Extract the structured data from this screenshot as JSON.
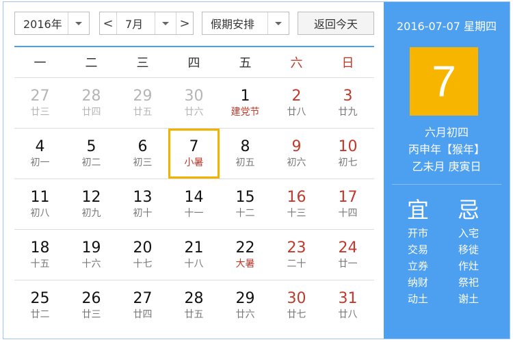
{
  "toolbar": {
    "year": "2016年",
    "month": "7月",
    "holiday": "假期安排",
    "prev": "<",
    "next": ">",
    "today_btn": "返回今天"
  },
  "weekdays": [
    "一",
    "二",
    "三",
    "四",
    "五",
    "六",
    "日"
  ],
  "weeks": [
    [
      {
        "d": "27",
        "l": "廿三"
      },
      {
        "d": "28",
        "l": "廿四"
      },
      {
        "d": "29",
        "l": "廿五"
      },
      {
        "d": "30",
        "l": "廿六"
      },
      {
        "d": "1",
        "l": "建党节"
      },
      {
        "d": "2",
        "l": "廿八"
      },
      {
        "d": "3",
        "l": "廿九"
      }
    ],
    [
      {
        "d": "4",
        "l": "初一"
      },
      {
        "d": "5",
        "l": "初二"
      },
      {
        "d": "6",
        "l": "初三"
      },
      {
        "d": "7",
        "l": "小暑"
      },
      {
        "d": "8",
        "l": "初五"
      },
      {
        "d": "9",
        "l": "初六"
      },
      {
        "d": "10",
        "l": "初七"
      }
    ],
    [
      {
        "d": "11",
        "l": "初八"
      },
      {
        "d": "12",
        "l": "初九"
      },
      {
        "d": "13",
        "l": "初十"
      },
      {
        "d": "14",
        "l": "十一"
      },
      {
        "d": "15",
        "l": "十二"
      },
      {
        "d": "16",
        "l": "十三"
      },
      {
        "d": "17",
        "l": "十四"
      }
    ],
    [
      {
        "d": "18",
        "l": "十五"
      },
      {
        "d": "19",
        "l": "十六"
      },
      {
        "d": "20",
        "l": "十七"
      },
      {
        "d": "21",
        "l": "十八"
      },
      {
        "d": "22",
        "l": "大暑"
      },
      {
        "d": "23",
        "l": "二十"
      },
      {
        "d": "24",
        "l": "廿一"
      }
    ],
    [
      {
        "d": "25",
        "l": "廿二"
      },
      {
        "d": "26",
        "l": "廿三"
      },
      {
        "d": "27",
        "l": "廿四"
      },
      {
        "d": "28",
        "l": "廿五"
      },
      {
        "d": "29",
        "l": "廿六"
      },
      {
        "d": "30",
        "l": "廿七"
      },
      {
        "d": "31",
        "l": "廿八"
      }
    ]
  ],
  "panel": {
    "date_header": "2016-07-07 星期四",
    "day": "7",
    "lunar": "六月初四",
    "year_line": "丙申年【猴年】",
    "month_day_line": "乙未月 庚寅日",
    "yi_label": "宜",
    "ji_label": "忌",
    "yi": [
      "开市",
      "交易",
      "立券",
      "纳财",
      "动土"
    ],
    "ji": [
      "入宅",
      "移徙",
      "作灶",
      "祭祀",
      "谢土"
    ]
  },
  "colors": {
    "accent": "#4d9ff0",
    "today_border": "#f0b400",
    "weekend": "#c0392b",
    "day_box": "#f7b500"
  }
}
